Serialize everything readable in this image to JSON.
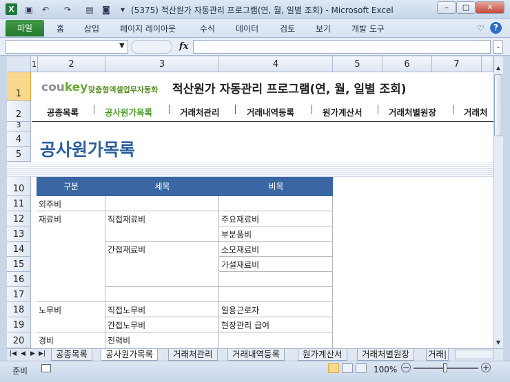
{
  "window": {
    "title": "(5375) 적산원가 자동관리 프로그램(연, 월, 일별 조회)  -  Microsoft Excel",
    "minimize": "–",
    "maximize": "□",
    "close": "✕"
  },
  "ribbon": {
    "file_tab": "파일",
    "tabs": [
      "홈",
      "삽입",
      "페이지 레이아웃",
      "수식",
      "데이터",
      "검토",
      "보기",
      "개발 도구"
    ]
  },
  "formula_bar": {
    "fx": "fx",
    "value": ""
  },
  "columns": [
    "1",
    "2",
    "3",
    "4",
    "5",
    "6",
    "7"
  ],
  "rows": [
    "1",
    "2",
    "3",
    "4",
    "5",
    "10",
    "11",
    "12",
    "13",
    "14",
    "15",
    "16",
    "17",
    "18",
    "19",
    "20"
  ],
  "header": {
    "logo_co": "cou",
    "logo_key": "key",
    "logo_sub": "맞춤형엑셀업무자동화",
    "program_title": "적산원가 자동관리 프로그램(연, 월, 일별 조회)"
  },
  "menu": [
    "공종목록",
    "공사원가목록",
    "거래처관리",
    "거래내역등록",
    "원가계산서",
    "거래처별원장",
    "거래처"
  ],
  "page_heading": "공사원가목록",
  "table": {
    "headers": [
      "구분",
      "세목",
      "비목"
    ],
    "rows": [
      [
        "외주비",
        "",
        ""
      ],
      [
        "재료비",
        "직접재료비",
        "주요재료비"
      ],
      [
        "",
        "",
        "부분품비"
      ],
      [
        "",
        "간접재료비",
        "소모재료비"
      ],
      [
        "",
        "",
        "가설재료비"
      ],
      [
        "",
        "",
        ""
      ],
      [
        "",
        "",
        ""
      ],
      [
        "노무비",
        "직접노무비",
        "일용근로자"
      ],
      [
        "",
        "간접노무비",
        "현장관리 급여"
      ],
      [
        "경비",
        "전력비",
        ""
      ]
    ]
  },
  "sheet_tabs": [
    "공종목록",
    "공사원가목록",
    "거래처관리",
    "거래내역등록",
    "원가계산서",
    "거래처별원장",
    "거래|"
  ],
  "status": {
    "ready": "준비",
    "zoom": "100%"
  }
}
